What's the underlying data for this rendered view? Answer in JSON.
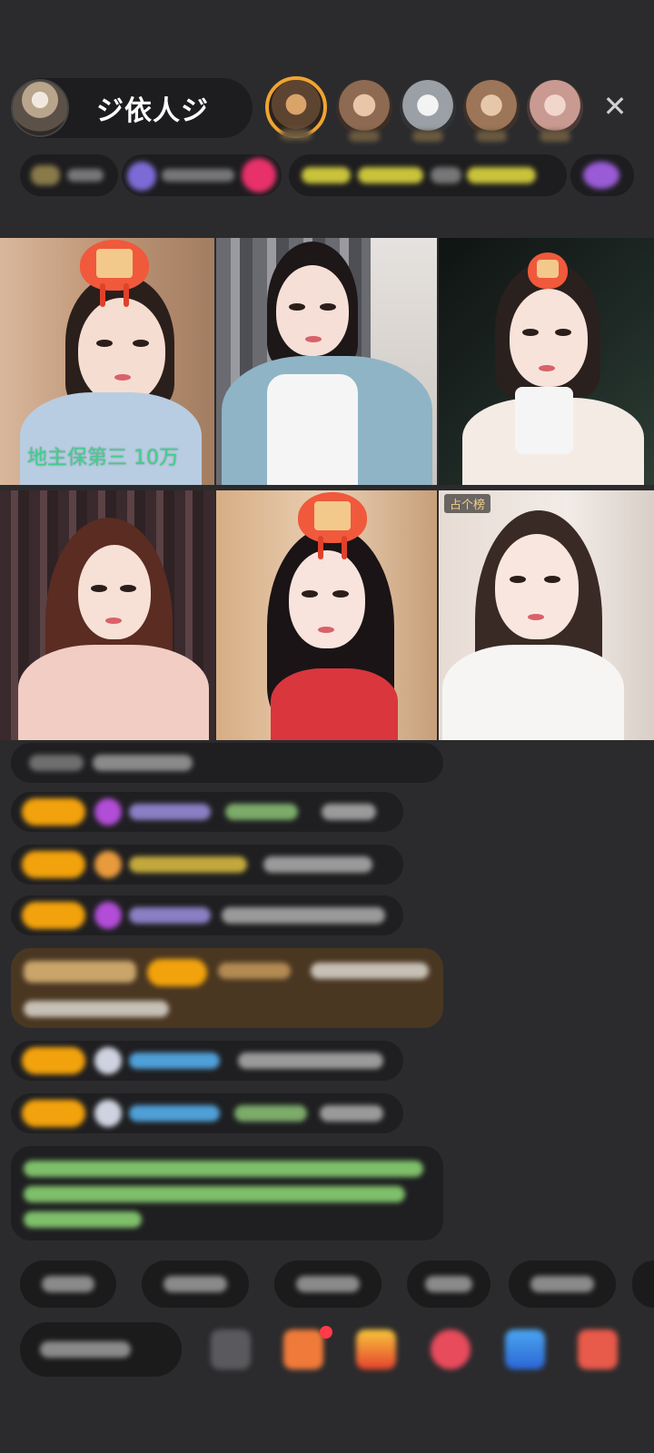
{
  "host": {
    "name": "ジ依人ジ",
    "avatar_icon": "host-avatar-icon"
  },
  "viewers": [
    "viewer-avatar-1",
    "viewer-avatar-2",
    "viewer-avatar-3",
    "viewer-avatar-4",
    "viewer-avatar-5"
  ],
  "close_icon": "✕",
  "video_grid": {
    "tile_1_caption": "地主保第三   10万",
    "tile_6_tag": "占个榜"
  },
  "colors": {
    "background": "#2b2b2d",
    "badge": "#f2a20c",
    "caption": "#3fd089",
    "highlight_comment": "#5a3f1c"
  }
}
